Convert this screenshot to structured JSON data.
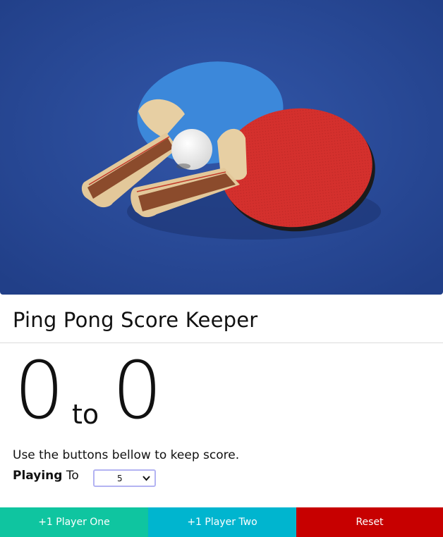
{
  "header": {
    "title": "Ping Pong Score Keeper"
  },
  "hero_image": {
    "icon": "ping-pong-paddles-image"
  },
  "score": {
    "player_one": "0",
    "separator": "to",
    "player_two": "0"
  },
  "instructions": "Use the buttons bellow to keep score.",
  "playing_to": {
    "label_bold": "Playing",
    "label_rest": "To",
    "selected_value": "5"
  },
  "buttons": {
    "player_one_label": "+1 Player One",
    "player_two_label": "+1 Player Two",
    "reset_label": "Reset"
  },
  "colors": {
    "player_one": "#0fc5a0",
    "player_two": "#00b5cf",
    "reset": "#c70000",
    "table_blue": "#2a4c9c",
    "paddle_blue": "#3c88da",
    "paddle_red": "#d4302d"
  }
}
